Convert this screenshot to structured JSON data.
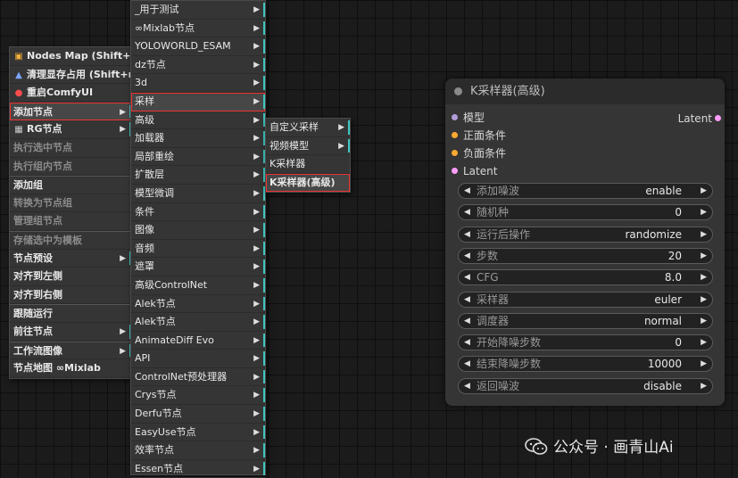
{
  "context_menu": {
    "items": [
      {
        "label": "Nodes Map (Shift+m)",
        "icon": "sitemap-icon",
        "disabled": false,
        "submenu": false
      },
      {
        "label": "清理显存占用 (Shift+r)",
        "icon": "rocket-icon",
        "disabled": false,
        "submenu": false
      },
      {
        "label": "重启ComfyUI",
        "icon": "restart-icon",
        "disabled": false,
        "submenu": false
      },
      {
        "label": "添加节点",
        "icon": "",
        "disabled": false,
        "submenu": true
      },
      {
        "label": "RG节点",
        "icon": "rg-icon",
        "disabled": false,
        "submenu": true
      },
      {
        "label": "执行选中节点",
        "icon": "",
        "disabled": true,
        "submenu": false
      },
      {
        "label": "执行组内节点",
        "icon": "",
        "disabled": true,
        "submenu": false
      },
      {
        "label": "添加组",
        "icon": "",
        "disabled": false,
        "submenu": false
      },
      {
        "label": "转换为节点组",
        "icon": "",
        "disabled": true,
        "submenu": false
      },
      {
        "label": "管理组节点",
        "icon": "",
        "disabled": true,
        "submenu": false
      },
      {
        "label": "存储选中为模板",
        "icon": "",
        "disabled": true,
        "submenu": false
      },
      {
        "label": "节点预设",
        "icon": "",
        "disabled": false,
        "submenu": true
      },
      {
        "label": "对齐到左侧",
        "icon": "",
        "disabled": false,
        "submenu": false
      },
      {
        "label": "对齐到右侧",
        "icon": "",
        "disabled": false,
        "submenu": false
      },
      {
        "label": "跟随运行",
        "icon": "",
        "disabled": false,
        "submenu": false
      },
      {
        "label": "前往节点",
        "icon": "",
        "disabled": false,
        "submenu": true
      },
      {
        "label": "工作流图像",
        "icon": "",
        "disabled": false,
        "submenu": true
      },
      {
        "label": "节点地图 ∞Mixlab",
        "icon": "",
        "disabled": false,
        "submenu": false
      }
    ]
  },
  "category_menu": {
    "items": [
      "_用于测试",
      "∞Mixlab节点",
      "YOLOWORLD_ESAM",
      "dz节点",
      "3d",
      "采样",
      "高级",
      "加载器",
      "局部重绘",
      "扩散层",
      "模型微调",
      "条件",
      "图像",
      "音频",
      "遮罩",
      "高级ControlNet",
      "Alek节点",
      "Alek节点",
      "AnimateDiff Evo",
      "API",
      "ControlNet预处理器",
      "Crys节点",
      "Derfu节点",
      "EasyUse节点",
      "效率节点",
      "Essen节点"
    ]
  },
  "sampling_menu": {
    "items": [
      "自定义采样",
      "视频模型",
      "K采样器",
      "K采样器(高级)"
    ]
  },
  "node": {
    "title": "K采样器(高级)",
    "inputs": [
      {
        "name": "模型",
        "color": "#b39ddb"
      },
      {
        "name": "正面条件",
        "color": "#ffa931"
      },
      {
        "name": "负面条件",
        "color": "#ffa931"
      },
      {
        "name": "Latent",
        "color": "#ff9cf9"
      }
    ],
    "output": {
      "name": "Latent",
      "color": "#ff9cf9"
    },
    "widgets": [
      {
        "name": "添加噪波",
        "value": "enable"
      },
      {
        "name": "随机种",
        "value": "0"
      },
      {
        "name": "运行后操作",
        "value": "randomize"
      },
      {
        "name": "步数",
        "value": "20"
      },
      {
        "name": "CFG",
        "value": "8.0"
      },
      {
        "name": "采样器",
        "value": "euler"
      },
      {
        "name": "调度器",
        "value": "normal"
      },
      {
        "name": "开始降噪步数",
        "value": "0"
      },
      {
        "name": "结束降噪步数",
        "value": "10000"
      },
      {
        "name": "返回噪波",
        "value": "disable"
      }
    ]
  },
  "watermark": {
    "text": "公众号 · 画青山Ai"
  }
}
